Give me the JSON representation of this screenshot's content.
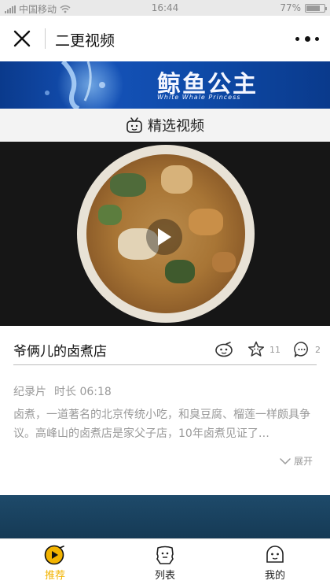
{
  "status_bar": {
    "carrier": "中国移动",
    "time": "16:44",
    "battery_percent": "77%",
    "battery_level": 0.77
  },
  "header": {
    "title": "二更视频",
    "close_icon": "close-icon",
    "more_icon": "more-icon"
  },
  "banner": {
    "title": "鲸鱼公主",
    "subtitle": "White Whale Princess"
  },
  "section": {
    "icon": "tv-icon",
    "title": "精选视频"
  },
  "video": {
    "play_icon": "play-icon",
    "title": "爷俩儿的卤煮店",
    "actions": [
      {
        "icon": "mascot-icon",
        "count": ""
      },
      {
        "icon": "star-face-icon",
        "count": "11"
      },
      {
        "icon": "comment-icon",
        "count": "2"
      }
    ],
    "category": "纪录片",
    "duration": "时长 06:18",
    "description": "卤煮，一道著名的北京传统小吃，和臭豆腐、榴莲一样颇具争议。高峰山的卤煮店是家父子店，10年卤煮见证了…",
    "expand_label": "展开"
  },
  "tabbar": {
    "tabs": [
      {
        "label": "推荐",
        "icon": "recommend-icon",
        "active": true
      },
      {
        "label": "列表",
        "icon": "list-icon",
        "active": false
      },
      {
        "label": "我的",
        "icon": "profile-icon",
        "active": false
      }
    ]
  },
  "colors": {
    "accent": "#f2b300",
    "banner_blue": "#0e4aa8",
    "muted_text": "#999999"
  }
}
